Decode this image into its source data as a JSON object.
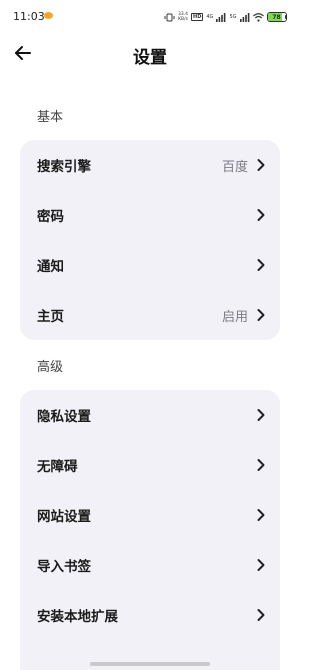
{
  "status_bar": {
    "time": "11:03",
    "speed": "33.4\nKB/s",
    "hd_label": "HD",
    "net1": "4G",
    "net2": "5G",
    "battery": "78",
    "battery_level": 0.78
  },
  "header": {
    "title": "设置"
  },
  "sections": [
    {
      "title": "基本",
      "items": [
        {
          "label": "搜索引擎",
          "value": "百度"
        },
        {
          "label": "密码",
          "value": ""
        },
        {
          "label": "通知",
          "value": ""
        },
        {
          "label": "主页",
          "value": "启用"
        }
      ]
    },
    {
      "title": "高级",
      "items": [
        {
          "label": "隐私设置",
          "value": ""
        },
        {
          "label": "无障碍",
          "value": ""
        },
        {
          "label": "网站设置",
          "value": ""
        },
        {
          "label": "导入书签",
          "value": ""
        },
        {
          "label": "安装本地扩展",
          "value": ""
        }
      ]
    }
  ],
  "colors": {
    "card_background": "#f1f1f7",
    "secondary_text": "#7b7b82",
    "battery_fill": "#7ed957"
  }
}
